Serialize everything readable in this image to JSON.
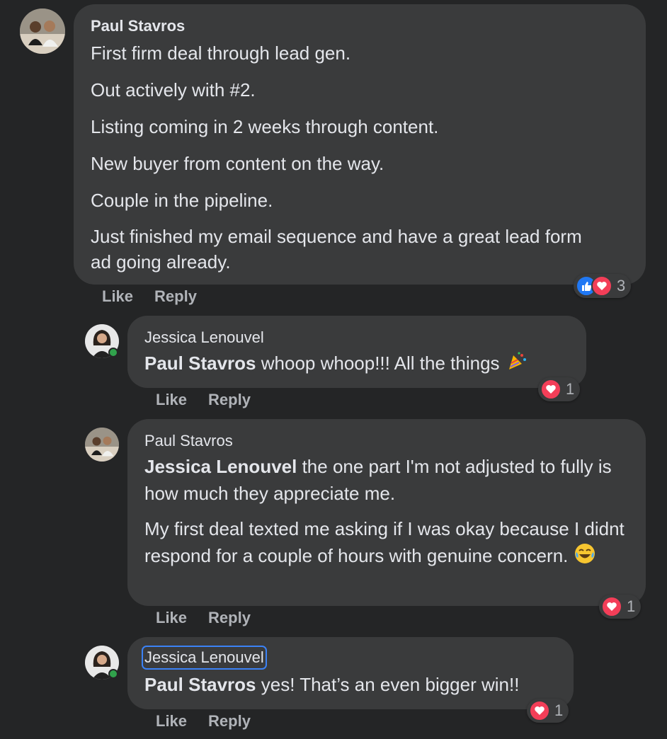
{
  "colors": {
    "background": "#242526",
    "bubble": "#3a3b3c",
    "text": "#e4e6eb",
    "secondary_text": "#b0b3b8",
    "like_blue": "#2078f4",
    "love_red": "#f33e58",
    "online_green": "#31a24c"
  },
  "actions": {
    "like": "Like",
    "reply": "Reply"
  },
  "comments": [
    {
      "author": "Paul Stavros",
      "paragraphs": [
        "First firm deal through lead gen.",
        "Out actively with #2.",
        "Listing coming in 2 weeks through content.",
        "New buyer from content on the way.",
        "Couple in the pipeline.",
        "Just finished my email sequence and have a great lead form ad going already."
      ],
      "reactions": {
        "icons": [
          "like-icon",
          "love-icon"
        ],
        "count": "3"
      }
    },
    {
      "author": "Jessica Lenouvel",
      "mention": "Paul Stavros",
      "text": "whoop whoop!!! All the things",
      "emoji": "confetti-emoji",
      "reactions": {
        "icons": [
          "love-icon"
        ],
        "count": "1"
      }
    },
    {
      "author": "Paul Stavros",
      "mention": "Jessica Lenouvel",
      "text": "the one part I'm not adjusted to fully is how much they appreciate me.",
      "text2": "My first deal texted me asking if I was okay because I didnt respond for a couple of hours with genuine concern.",
      "emoji": "laughing-tears-emoji",
      "reactions": {
        "icons": [
          "love-icon"
        ],
        "count": "1"
      }
    },
    {
      "author": "Jessica Lenouvel",
      "mention": "Paul Stavros",
      "text": "yes! That’s an even bigger win!!",
      "reactions": {
        "icons": [
          "love-icon"
        ],
        "count": "1"
      }
    }
  ]
}
